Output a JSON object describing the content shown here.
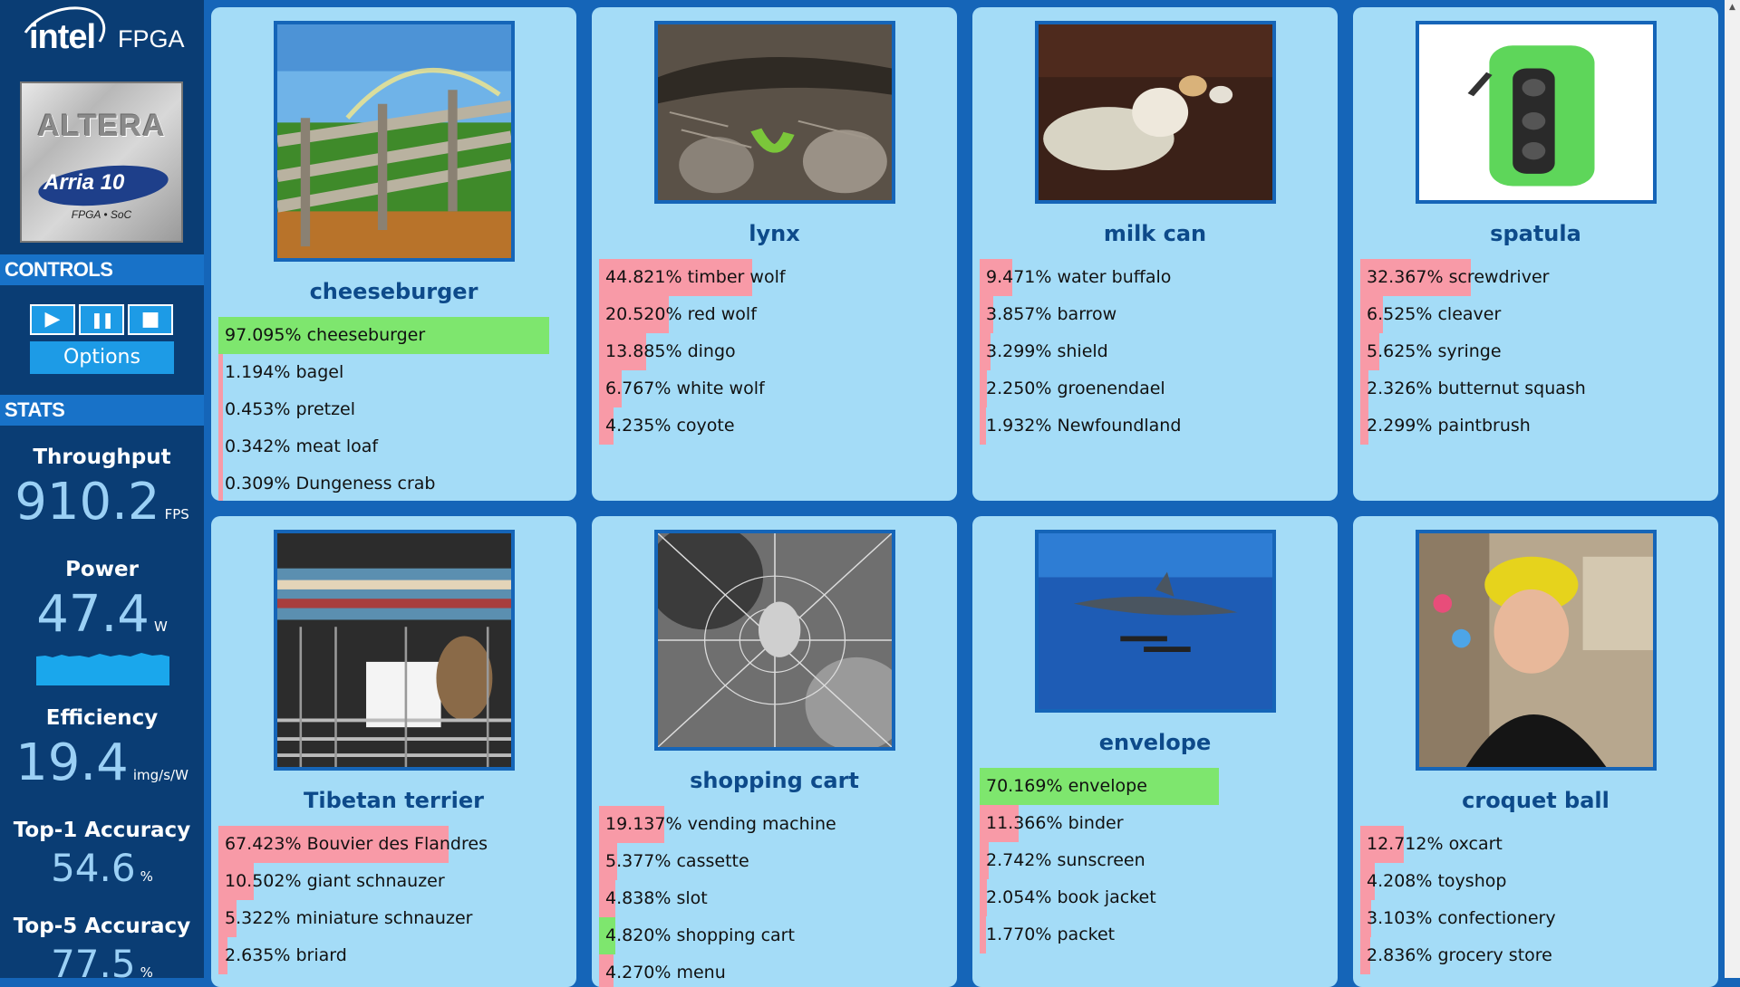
{
  "brand": {
    "logo_text": "intel",
    "product_text": "FPGA"
  },
  "chip": {
    "brand": "ALTERA",
    "product": "Arria 10",
    "subtitle": "FPGA • SoC"
  },
  "controls": {
    "header": "CONTROLS",
    "play_icon": "▶",
    "pause_icon": "❚❚",
    "stop_icon": "■",
    "options_label": "Options"
  },
  "stats": {
    "header": "STATS",
    "throughput": {
      "label": "Throughput",
      "value": "910.2",
      "unit": "FPS"
    },
    "power": {
      "label": "Power",
      "value": "47.4",
      "unit": "W"
    },
    "efficiency": {
      "label": "Efficiency",
      "value": "19.4",
      "unit": "img/s/W"
    },
    "top1": {
      "label": "Top-1 Accuracy",
      "value": "54.6",
      "unit": "%"
    },
    "top5": {
      "label": "Top-5 Accuracy",
      "value": "77.5",
      "unit": "%"
    }
  },
  "colors": {
    "sidebar_bg": "#0a3d74",
    "page_bg": "#1565b8",
    "card_bg": "#a4dcf7",
    "correct_bar": "#7ee66e",
    "wrong_bar": "#f89aa7",
    "title_color": "#0d4a8a",
    "stat_value_color": "#9bd0f5"
  },
  "cards": [
    {
      "title": "cheeseburger",
      "image": "fence-meadow-rainbow",
      "predictions": [
        {
          "text": "97.095% cheeseburger",
          "pct": 97.095,
          "correct": true
        },
        {
          "text": "1.194% bagel",
          "pct": 1.194,
          "correct": false
        },
        {
          "text": "0.453% pretzel",
          "pct": 0.453,
          "correct": false
        },
        {
          "text": "0.342% meat loaf",
          "pct": 0.342,
          "correct": false
        },
        {
          "text": "0.309% Dungeness crab",
          "pct": 0.309,
          "correct": false
        }
      ]
    },
    {
      "title": "lynx",
      "image": "lizard-on-rocks",
      "predictions": [
        {
          "text": "44.821% timber wolf",
          "pct": 44.821,
          "correct": false
        },
        {
          "text": "20.520% red wolf",
          "pct": 20.52,
          "correct": false
        },
        {
          "text": "13.885% dingo",
          "pct": 13.885,
          "correct": false
        },
        {
          "text": "6.767% white wolf",
          "pct": 6.767,
          "correct": false
        },
        {
          "text": "4.235% coyote",
          "pct": 4.235,
          "correct": false
        }
      ]
    },
    {
      "title": "milk can",
      "image": "dog-on-couch",
      "predictions": [
        {
          "text": "9.471% water buffalo",
          "pct": 9.471,
          "correct": false
        },
        {
          "text": "3.857% barrow",
          "pct": 3.857,
          "correct": false
        },
        {
          "text": "3.299% shield",
          "pct": 3.299,
          "correct": false
        },
        {
          "text": "2.250% groenendael",
          "pct": 2.25,
          "correct": false
        },
        {
          "text": "1.932% Newfoundland",
          "pct": 1.932,
          "correct": false
        }
      ]
    },
    {
      "title": "spatula",
      "image": "green-speaker-case",
      "predictions": [
        {
          "text": "32.367% screwdriver",
          "pct": 32.367,
          "correct": false
        },
        {
          "text": "6.525% cleaver",
          "pct": 6.525,
          "correct": false
        },
        {
          "text": "5.625% syringe",
          "pct": 5.625,
          "correct": false
        },
        {
          "text": "2.326% butternut squash",
          "pct": 2.326,
          "correct": false
        },
        {
          "text": "2.299% paintbrush",
          "pct": 2.299,
          "correct": false
        }
      ]
    },
    {
      "title": "Tibetan terrier",
      "image": "rodent-in-cage",
      "predictions": [
        {
          "text": "67.423% Bouvier des Flandres",
          "pct": 67.423,
          "correct": false
        },
        {
          "text": "10.502% giant schnauzer",
          "pct": 10.502,
          "correct": false
        },
        {
          "text": "5.322% miniature schnauzer",
          "pct": 5.322,
          "correct": false
        },
        {
          "text": "2.635% briard",
          "pct": 2.635,
          "correct": false
        }
      ]
    },
    {
      "title": "shopping cart",
      "image": "spider-web",
      "predictions": [
        {
          "text": "19.137% vending machine",
          "pct": 19.137,
          "correct": false
        },
        {
          "text": "5.377% cassette",
          "pct": 5.377,
          "correct": false
        },
        {
          "text": "4.838% slot",
          "pct": 4.838,
          "correct": false
        },
        {
          "text": "4.820% shopping cart",
          "pct": 4.82,
          "correct": true
        },
        {
          "text": "4.270% menu",
          "pct": 4.27,
          "correct": false
        }
      ]
    },
    {
      "title": "envelope",
      "image": "shark-underwater",
      "predictions": [
        {
          "text": "70.169% envelope",
          "pct": 70.169,
          "correct": true
        },
        {
          "text": "11.366% binder",
          "pct": 11.366,
          "correct": false
        },
        {
          "text": "2.742% sunscreen",
          "pct": 2.742,
          "correct": false
        },
        {
          "text": "2.054% book jacket",
          "pct": 2.054,
          "correct": false
        },
        {
          "text": "1.770% packet",
          "pct": 1.77,
          "correct": false
        }
      ]
    },
    {
      "title": "croquet ball",
      "image": "woman-with-shower-cap",
      "predictions": [
        {
          "text": "12.712% oxcart",
          "pct": 12.712,
          "correct": false
        },
        {
          "text": "4.208% toyshop",
          "pct": 4.208,
          "correct": false
        },
        {
          "text": "3.103% confectionery",
          "pct": 3.103,
          "correct": false
        },
        {
          "text": "2.836% grocery store",
          "pct": 2.836,
          "correct": false
        }
      ]
    }
  ]
}
